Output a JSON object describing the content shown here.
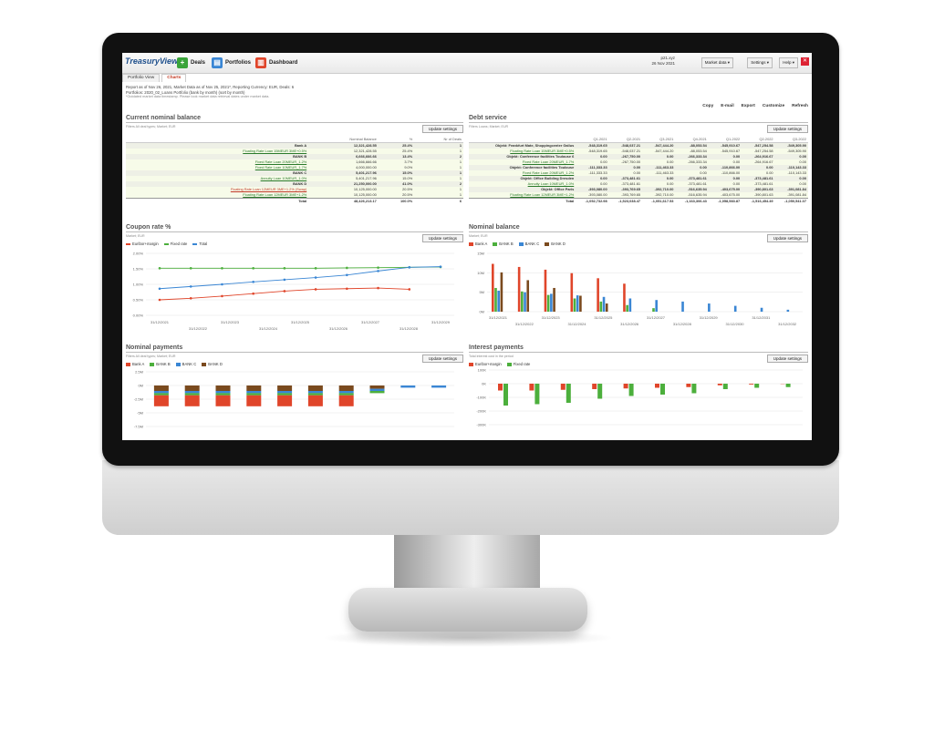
{
  "app": {
    "logo": "TreasuryView",
    "nav": [
      "Deals",
      "Portfolios",
      "Dashboard"
    ],
    "user": "p21.xyz",
    "date": "26 Nov 2021",
    "market_data": "Market data",
    "settings": "Settings",
    "help": "Help"
  },
  "tabs": [
    "Portfolio View",
    "Charts"
  ],
  "info": {
    "line1": "Report as of Nov 26, 2021, Market Data as of Nov 25, 2021*, Reporting Currency: EUR, Deals: 6",
    "line2": "Portfolios: 2020_02_Loans Portfolio (bank by month) (sort by month)",
    "line3": "*Outdated market data timestamp. Please look market data retrieval dates under market data."
  },
  "actions": [
    "Copy",
    "E-mail",
    "Export",
    "Customize",
    "Refresh"
  ],
  "update_label": "Update settings",
  "balance": {
    "title": "Current nominal balance",
    "subtitle": "Filters All deal types; Market; EUR",
    "headers": [
      "",
      "Nominal Balance",
      "%",
      "Nr of Deals"
    ],
    "rows": [
      {
        "k": "grp",
        "name": "Bank A",
        "bal": "12,321,428.55",
        "pct": "25.4%",
        "n": "1"
      },
      {
        "k": "sub",
        "name": "Floating Rate Loan 15MEUR 3ME+0.5%",
        "bal": "12,321,428.55",
        "pct": "25.4%",
        "n": "1"
      },
      {
        "k": "grp",
        "name": "BANK B",
        "bal": "6,666,666.66",
        "pct": "13.4%",
        "n": "2"
      },
      {
        "k": "sub",
        "name": "Fixed Rate Loan 20MEUR_1.2%",
        "bal": "1,666,666.66",
        "pct": "3.7%",
        "n": "1"
      },
      {
        "k": "sub",
        "name": "Fixed Rate Loan 10MEUR_1.7%",
        "bal": "4,000,000.00",
        "pct": "9.0%",
        "n": "1"
      },
      {
        "k": "grp",
        "name": "BANK C",
        "bal": "5,401,217.96",
        "pct": "15.0%",
        "n": "1"
      },
      {
        "k": "sub",
        "name": "Annuity Loan 10MEUR_1.0%",
        "bal": "5,401,217.96",
        "pct": "15.0%",
        "n": "1"
      },
      {
        "k": "grp",
        "name": "BANK D",
        "bal": "21,250,000.00",
        "pct": "41.0%",
        "n": "2"
      },
      {
        "k": "subred",
        "name": "Floating Rate Loan 12MEUR 3ME+1.2% (Swap)",
        "bal": "10,125,000.00",
        "pct": "20.5%",
        "n": "1"
      },
      {
        "k": "sub",
        "name": "Floating Rate Loan 12MEUR 3ME+1.2%",
        "bal": "10,125,000.00",
        "pct": "20.5%",
        "n": "1"
      },
      {
        "k": "tot",
        "name": "Total",
        "bal": "48,426,213.17",
        "pct": "100.0%",
        "n": "6"
      }
    ]
  },
  "debt": {
    "title": "Debt service",
    "subtitle": "Filters Loans; Market; EUR",
    "headers": [
      "",
      "Q1-2021",
      "Q2-2021",
      "Q3-2021",
      "Q4-2021",
      "Q1-2022",
      "Q2-2022",
      "Q3-2022"
    ],
    "rows": [
      {
        "k": "grp",
        "name": "Objekt: Frankfurt Mate, Shoppingcenter Gallus",
        "v": [
          "-548,319.65",
          "-548,037.21",
          "-547,444.20",
          "-88,053.54",
          "-545,910.67",
          "-547,254.58",
          "-549,305.90"
        ]
      },
      {
        "k": "sub",
        "name": "Floating Rate Loan 15MEUR 3ME+0.5%",
        "v": [
          "-548,319.65",
          "-548,037.21",
          "-547,444.20",
          "-88,053.54",
          "-545,910.67",
          "-547,254.58",
          "-549,305.90"
        ]
      },
      {
        "k": "grp",
        "name": "Objekt: Conference facilities Toulouse 6",
        "v": [
          "0.00",
          "-267,750.00",
          "0.00",
          "-266,333.34",
          "0.00",
          "-264,916.67",
          "0.00"
        ]
      },
      {
        "k": "sub",
        "name": "Fixed Rate Loan 20MEUR_1.7%",
        "v": [
          "0.00",
          "-267,750.00",
          "0.00",
          "-266,333.34",
          "0.00",
          "-264,916.67",
          "0.00"
        ]
      },
      {
        "k": "grp",
        "name": "Objekt: Conference facilities Toulouse",
        "v": [
          "-111,333.33",
          "0.00",
          "-111,463.33",
          "0.00",
          "-110,866.00",
          "0.00",
          "-110,143.33"
        ]
      },
      {
        "k": "sub",
        "name": "Fixed Rate Loan 20MEUR_1.2%",
        "v": [
          "-111,333.33",
          "0.00",
          "-111,463.33",
          "0.00",
          "-110,866.00",
          "0.00",
          "-110,143.33"
        ]
      },
      {
        "k": "grp",
        "name": "Objekt: Office Building Dresden",
        "v": [
          "0.00",
          "-373,481.61",
          "0.00",
          "-373,481.61",
          "0.00",
          "-373,481.61",
          "0.00"
        ]
      },
      {
        "k": "sub",
        "name": "Annuity Loan 10MEUR_1.0%",
        "v": [
          "0.00",
          "-373,481.61",
          "0.00",
          "-373,481.61",
          "0.00",
          "-373,481.61",
          "0.00"
        ]
      },
      {
        "k": "grp",
        "name": "Objekt: Office Paris",
        "v": [
          "-393,080.00",
          "-393,769.65",
          "-392,710.00",
          "-516,635.94",
          "-403,675.00",
          "-390,801.63",
          "-391,081.84"
        ]
      },
      {
        "k": "sub",
        "name": "Floating Rate Loan 12MEUR 3ME+1.2%",
        "v": [
          "-393,080.00",
          "-393,769.65",
          "-392,710.00",
          "-516,635.94",
          "-403,675.00",
          "-390,801.63",
          "-391,081.84"
        ]
      },
      {
        "k": "tot",
        "name": "Total",
        "v": [
          "-1,052,732.98",
          "-1,523,038.47",
          "-1,051,617.53",
          "-1,163,306.43",
          "-1,058,583.87",
          "-1,516,454.49",
          "-1,050,541.07"
        ]
      }
    ]
  },
  "coupon": {
    "title": "Coupon rate %",
    "subtitle": "Market; EUR",
    "legend": [
      "Euribor+margin",
      "Fixed rate",
      "Total"
    ],
    "colors": [
      "#e0452a",
      "#4caf3c",
      "#3a86d4"
    ],
    "y_ticks": [
      "2.00%",
      "1.50%",
      "1.00%",
      "0.50%",
      "0.00%"
    ],
    "x_ticks_top": [
      "31/12/2021",
      "31/12/2023",
      "31/12/2025",
      "31/12/2027",
      "31/12/2029"
    ],
    "x_ticks_bottom": [
      "31/12/2022",
      "31/12/2024",
      "31/12/2026",
      "31/12/2028"
    ]
  },
  "nominal": {
    "title": "Nominal balance",
    "subtitle": "Market; EUR",
    "legend": [
      "Bank A",
      "BANK B",
      "BANK C",
      "BANK D"
    ],
    "colors": [
      "#e0452a",
      "#4caf3c",
      "#3a86d4",
      "#7a4a1e"
    ],
    "y_ticks": [
      "15M",
      "10M",
      "5M",
      "0M"
    ],
    "x_ticks_top": [
      "31/12/2021",
      "31/12/2023",
      "31/12/2025",
      "31/12/2027",
      "31/12/2029",
      "31/12/2031"
    ],
    "x_ticks_bottom": [
      "31/12/2022",
      "31/12/2024",
      "31/12/2026",
      "31/12/2028",
      "31/12/2030",
      "31/12/2032"
    ]
  },
  "payments": {
    "title": "Nominal payments",
    "subtitle": "Filters All deal types; Market; EUR",
    "legend": [
      "Bank A",
      "BANK B",
      "BANK C",
      "BANK D"
    ],
    "colors": [
      "#e0452a",
      "#4caf3c",
      "#3a86d4",
      "#7a4a1e"
    ],
    "y_ticks": [
      "2.5M",
      "0M",
      "-2.5M",
      "-5M",
      "-7.5M"
    ]
  },
  "interest": {
    "title": "Interest payments",
    "subtitle": "Total interest cost in the period",
    "legend": [
      "Euribor+margin",
      "Fixed rate"
    ],
    "colors": [
      "#e0452a",
      "#4caf3c"
    ],
    "y_ticks": [
      "100K",
      "0K",
      "-100K",
      "-200K",
      "-300K"
    ]
  },
  "chart_data": [
    {
      "type": "line",
      "title": "Coupon rate %",
      "x": [
        "2021",
        "2022",
        "2023",
        "2024",
        "2025",
        "2026",
        "2027",
        "2028",
        "2029",
        "2030"
      ],
      "ylim": [
        0,
        2
      ],
      "series": [
        {
          "name": "Euribor+margin",
          "values": [
            0.5,
            0.55,
            0.62,
            0.7,
            0.78,
            0.84,
            0.86,
            0.88,
            0.84,
            null
          ]
        },
        {
          "name": "Fixed rate",
          "values": [
            1.52,
            1.52,
            1.52,
            1.52,
            1.52,
            1.52,
            1.53,
            1.54,
            1.55,
            1.56
          ]
        },
        {
          "name": "Total",
          "values": [
            0.86,
            0.93,
            1.0,
            1.08,
            1.15,
            1.22,
            1.3,
            1.43,
            1.55,
            1.57
          ]
        }
      ]
    },
    {
      "type": "bar",
      "title": "Nominal balance",
      "categories": [
        "2021",
        "2022",
        "2023",
        "2024",
        "2025",
        "2026",
        "2027",
        "2028",
        "2029",
        "2030",
        "2031",
        "2032"
      ],
      "ylim": [
        0,
        15
      ],
      "series": [
        {
          "name": "Bank A",
          "values": [
            12.3,
            11.5,
            10.8,
            9.9,
            8.6,
            7.2,
            0,
            0,
            0,
            0,
            0,
            0
          ]
        },
        {
          "name": "BANK B",
          "values": [
            6.1,
            5.2,
            4.3,
            3.4,
            2.6,
            1.7,
            0.9,
            0,
            0,
            0,
            0,
            0
          ]
        },
        {
          "name": "BANK C",
          "values": [
            5.4,
            5.0,
            4.6,
            4.2,
            3.8,
            3.4,
            3.0,
            2.6,
            2.1,
            1.5,
            1.0,
            0.5
          ]
        },
        {
          "name": "BANK D",
          "values": [
            10.1,
            8.1,
            6.1,
            4.1,
            2.1,
            0,
            0,
            0,
            0,
            0,
            0,
            0
          ]
        }
      ]
    },
    {
      "type": "bar",
      "title": "Nominal payments",
      "categories": [
        "1",
        "2",
        "3",
        "4",
        "5",
        "6",
        "7",
        "8",
        "9",
        "10"
      ],
      "ylim": [
        -7.5,
        2.5
      ],
      "series": [
        {
          "name": "Bank A",
          "values": [
            -2.0,
            -2.0,
            -2.0,
            -2.0,
            -2.0,
            -2.0,
            -2.0,
            0,
            0,
            0
          ]
        },
        {
          "name": "BANK B",
          "values": [
            -0.4,
            -0.4,
            -0.4,
            -0.4,
            -0.4,
            -0.4,
            -0.4,
            -0.4,
            0,
            0
          ]
        },
        {
          "name": "BANK C",
          "values": [
            -0.4,
            -0.4,
            -0.4,
            -0.4,
            -0.4,
            -0.4,
            -0.4,
            -0.4,
            -0.4,
            -0.4
          ]
        },
        {
          "name": "BANK D",
          "values": [
            -1.0,
            -1.0,
            -1.0,
            -1.0,
            -1.0,
            -1.0,
            -1.0,
            -0.6,
            0,
            0
          ]
        }
      ]
    },
    {
      "type": "bar",
      "title": "Interest payments",
      "categories": [
        "1",
        "2",
        "3",
        "4",
        "5",
        "6",
        "7",
        "8",
        "9",
        "10"
      ],
      "ylim": [
        -300,
        100
      ],
      "series": [
        {
          "name": "Euribor+margin",
          "values": [
            -50,
            -50,
            -45,
            -40,
            -35,
            -30,
            -25,
            -12,
            -6,
            -2
          ]
        },
        {
          "name": "Fixed rate",
          "values": [
            -160,
            -150,
            -140,
            -110,
            -90,
            -80,
            -70,
            -40,
            -30,
            -25
          ]
        }
      ]
    }
  ]
}
